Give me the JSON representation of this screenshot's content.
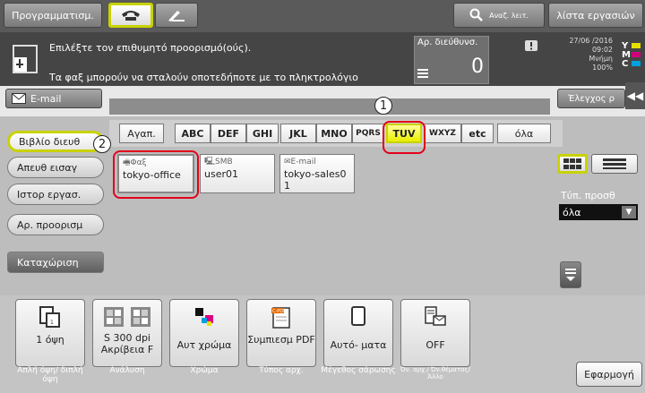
{
  "topbar": {
    "program_label": "Προγραμματισμ.",
    "search_label": "Αναζ. λειτ.",
    "job_list_label": "λίστα εργασιών"
  },
  "message": {
    "line1": "Επιλέξτε τον επιθυμητό προορισμό(ούς).",
    "line2": "Τα φαξ μπορούν να σταλούν οποτεδήποτε με το πληκτρολόγιο",
    "addr_count_label": "Αρ. διεύθυνσ.",
    "addr_count_value": "0",
    "date": "27/06 /2016",
    "time": "09:02",
    "memory_label": "Μνήμη",
    "memory_value": "100%",
    "toner_labels": [
      "Y",
      "M",
      "C"
    ]
  },
  "email_row": {
    "email_button": "E-mail",
    "check_button": "Έλεγχος ρ"
  },
  "left_menu": {
    "items": [
      "Βιβλίο διευθ",
      "Απευθ εισαγ",
      "Ιστορ εργασ.",
      "Αρ. προορισμ"
    ],
    "register": "Καταχώριση"
  },
  "index_tabs": [
    "Αγαπ.",
    "ABC",
    "DEF",
    "GHI",
    "JKL",
    "MNO",
    "PQRS",
    "TUV",
    "WXYZ",
    "etc",
    "όλα"
  ],
  "selected_tab": "TUV",
  "destinations": [
    {
      "type": "Φαξ",
      "name": "tokyo-office"
    },
    {
      "type": "SMB",
      "name": "user01"
    },
    {
      "type": "E-mail",
      "name": "tokyo-sales0 1"
    }
  ],
  "type_filter": {
    "label": "Τύπ. προσθ",
    "value": "όλα"
  },
  "bottom_settings": [
    {
      "value": "1 όψη",
      "label": "Απλή όψη/ διπλή όψη"
    },
    {
      "value": "S 300 dpi Ακρίβεια F",
      "label": "Ανάλυση"
    },
    {
      "value": "Αυτ χρώμα",
      "label": "Χρώμα"
    },
    {
      "value": "Συμπιεσμ PDF",
      "label": "Τύπος αρχ."
    },
    {
      "value": "Αυτό- ματα",
      "label": "Μέγεθος σάρωσης"
    },
    {
      "value": "OFF",
      "label": "Όν. αρχ./ Όν.θέματος/ Άλλο"
    }
  ],
  "apply_button": "Εφαρμογή",
  "callouts": [
    "1",
    "2"
  ]
}
